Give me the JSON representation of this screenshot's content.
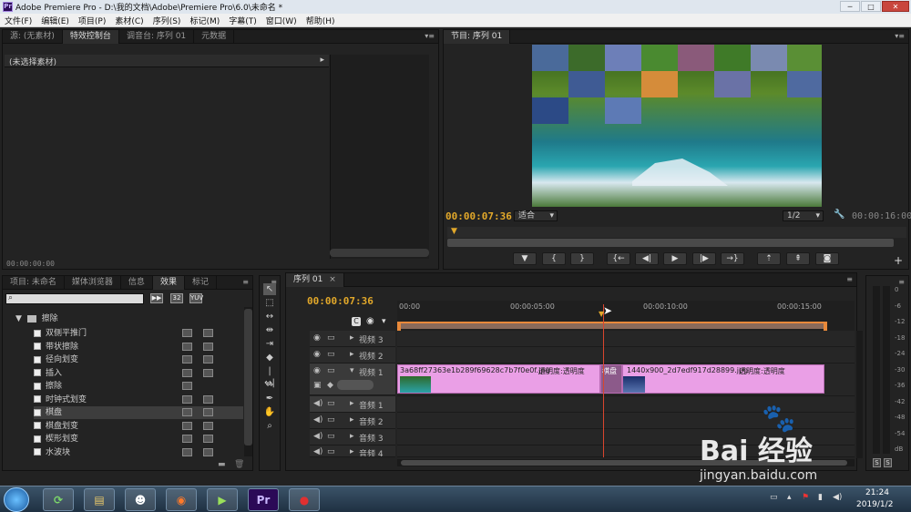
{
  "window": {
    "title": "Adobe Premiere Pro - D:\\我的文档\\Adobe\\Premiere Pro\\6.0\\未命名 *",
    "app_icon": "Pr"
  },
  "menu": [
    "文件(F)",
    "编辑(E)",
    "项目(P)",
    "素材(C)",
    "序列(S)",
    "标记(M)",
    "字幕(T)",
    "窗口(W)",
    "帮助(H)"
  ],
  "source_panel": {
    "tabs": [
      "源: (无素材)",
      "特效控制台",
      "调音台: 序列 01",
      "元数据"
    ],
    "active_tab": 1,
    "no_clip_label": "(未选择素材)",
    "timecode": "00:00:00:00"
  },
  "program_monitor": {
    "tab": "节目: 序列 01",
    "current_timecode": "00:00:07:36",
    "fit_label": "适合",
    "resolution": "1/2",
    "duration": "00:00:16:00"
  },
  "project_panel": {
    "tabs": [
      "项目: 未命名",
      "媒体浏览器",
      "信息",
      "效果",
      "标记"
    ],
    "active_tab": 3,
    "folder": "擦除",
    "effects": [
      "双侧平推门",
      "带状擦除",
      "径向划变",
      "插入",
      "擦除",
      "时钟式划变",
      "棋盘",
      "棋盘划变",
      "楔形划变",
      "水波块"
    ],
    "selected_effect": "棋盘",
    "badge_counts": [
      2,
      2,
      2,
      2,
      1,
      2,
      2,
      2,
      2,
      2
    ]
  },
  "timeline": {
    "tab": "序列 01",
    "current_timecode": "00:00:07:36",
    "ruler": [
      "00:00",
      "00:00:05:00",
      "00:00:10:00",
      "00:00:15:00"
    ],
    "tracks": [
      "视频 3",
      "视频 2",
      "视频 1",
      "音频 1",
      "音频 2",
      "音频 3",
      "音频 4"
    ],
    "clips": [
      {
        "name": "3a68ff27363e1b289f69628c7b7f0e0f.jpg",
        "effect": "透明度:透明度",
        "track": "视频 1"
      },
      {
        "name": "1440x900_2d7edf917d28899.jpg",
        "effect": "透明度:透明度",
        "track": "视频 1"
      }
    ],
    "transition_label": "棋盘"
  },
  "audio_meters": {
    "scale": [
      "0",
      "-6",
      "-12",
      "-18",
      "-24",
      "-30",
      "-36",
      "-42",
      "-48",
      "-54",
      "dB"
    ],
    "solo": [
      "S",
      "S"
    ]
  },
  "taskbar": {
    "time": "21:24",
    "date": "2019/1/2",
    "apps": [
      "Pr"
    ]
  },
  "watermark": {
    "brand": "Bai  经验",
    "url": "jingyan.baidu.com"
  },
  "colors": {
    "accent": "#e2a82a",
    "clip": "#ea9fe6",
    "timeline_bar": "#e8893a"
  }
}
